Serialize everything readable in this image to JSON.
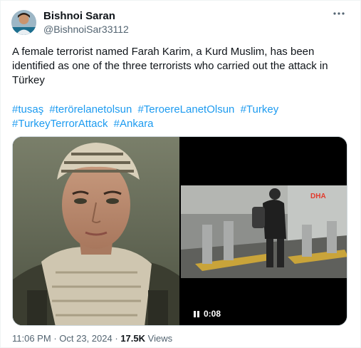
{
  "author": {
    "name": "Bishnoi Saran",
    "handle": "@BishnoiSar33112"
  },
  "tweet": {
    "text": "A female terrorist named Farah Karim, a Kurd Muslim, has been identified as one of the three terrorists who carried out the attack in Türkey",
    "hashtags": [
      "#tusaş",
      "#terörelanetolsun",
      "#TeroereLanetOlsun",
      "#Turkey",
      "#TurkeyTerrorAttack",
      "#Ankara"
    ]
  },
  "media": {
    "video_duration": "0:08",
    "video_watermark": "DHA"
  },
  "meta": {
    "time": "11:06 PM",
    "separator": "·",
    "date": "Oct 23, 2024",
    "views_count": "17.5K",
    "views_label": "Views"
  },
  "icons": {
    "more": "more-dots-icon",
    "pause": "pause-icon"
  },
  "colors": {
    "link": "#1d9bf0",
    "secondary_text": "#536471",
    "primary_text": "#0f1419"
  }
}
